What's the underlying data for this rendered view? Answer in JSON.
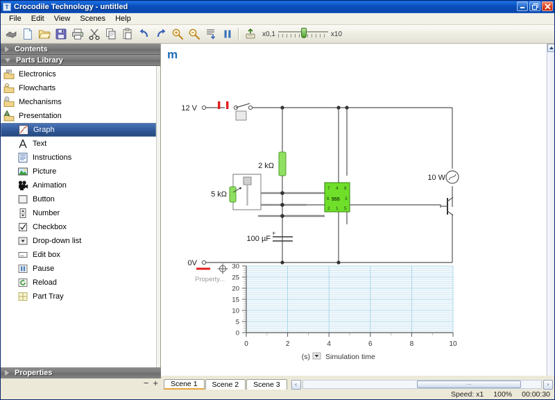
{
  "window": {
    "title": "Crocodile Technology - untitled",
    "icon": "T",
    "buttons": [
      {
        "name": "minimize",
        "glyph": "_"
      },
      {
        "name": "restore",
        "glyph": "❐"
      },
      {
        "name": "close",
        "glyph": "✕"
      }
    ]
  },
  "menubar": {
    "items": [
      "File",
      "Edit",
      "View",
      "Scenes",
      "Help"
    ]
  },
  "toolbar": {
    "buttons": [
      {
        "name": "select-tool-button",
        "icon": "pointer-icon",
        "title": "Select"
      },
      {
        "name": "new-button",
        "icon": "new-document-icon",
        "title": "New"
      },
      {
        "name": "open-button",
        "icon": "open-folder-icon",
        "title": "Open"
      },
      {
        "name": "save-button",
        "icon": "floppy-disk-icon",
        "title": "Save"
      },
      {
        "name": "print-button",
        "icon": "printer-icon",
        "title": "Print"
      },
      {
        "name": "cut-button",
        "icon": "scissors-icon",
        "title": "Cut"
      },
      {
        "name": "copy-button",
        "icon": "copy-icon",
        "title": "Copy"
      },
      {
        "name": "paste-button",
        "icon": "clipboard-paste-icon",
        "title": "Paste"
      },
      {
        "name": "undo-button",
        "icon": "undo-arrow-icon",
        "title": "Undo"
      },
      {
        "name": "redo-button",
        "icon": "redo-arrow-icon",
        "title": "Redo"
      },
      {
        "name": "zoom-in-button",
        "icon": "magnifier-plus-icon",
        "title": "Zoom In"
      },
      {
        "name": "zoom-out-button",
        "icon": "magnifier-minus-icon",
        "title": "Zoom Out"
      },
      {
        "name": "zoom-fit-button",
        "icon": "zoom-fit-icon",
        "title": "Zoom to fit"
      },
      {
        "name": "pause-button",
        "icon": "pause-icon",
        "title": "Pause"
      },
      {
        "name": "reset-button",
        "icon": "reset-icon",
        "title": "Reset"
      }
    ],
    "speed_min_label": "x0,1",
    "speed_max_label": "x10"
  },
  "sidebar": {
    "contents_header": "Contents",
    "parts_header": "Parts Library",
    "categories": [
      {
        "label": "Electronics",
        "icon": "electronics-folder-icon"
      },
      {
        "label": "Flowcharts",
        "icon": "flowcharts-folder-icon"
      },
      {
        "label": "Mechanisms",
        "icon": "mechanisms-folder-icon"
      },
      {
        "label": "Presentation",
        "icon": "presentation-folder-icon"
      }
    ],
    "presentation_items": [
      {
        "label": "Graph",
        "icon": "graph-icon",
        "selected": true
      },
      {
        "label": "Text",
        "icon": "text-a-icon",
        "selected": false
      },
      {
        "label": "Instructions",
        "icon": "instructions-icon",
        "selected": false
      },
      {
        "label": "Picture",
        "icon": "picture-icon",
        "selected": false
      },
      {
        "label": "Animation",
        "icon": "animation-camera-icon",
        "selected": false
      },
      {
        "label": "Button",
        "icon": "button-icon",
        "selected": false
      },
      {
        "label": "Number",
        "icon": "number-spinner-icon",
        "selected": false
      },
      {
        "label": "Checkbox",
        "icon": "checkbox-icon",
        "selected": false
      },
      {
        "label": "Drop-down list",
        "icon": "dropdown-icon",
        "selected": false
      },
      {
        "label": "Edit box",
        "icon": "edit-box-icon",
        "selected": false
      },
      {
        "label": "Pause",
        "icon": "pause-icon",
        "selected": false
      },
      {
        "label": "Reload",
        "icon": "reload-icon",
        "selected": false
      },
      {
        "label": "Part Tray",
        "icon": "part-tray-icon",
        "selected": false
      }
    ],
    "properties_header": "Properties"
  },
  "canvas": {
    "scene_label": "m",
    "circuit": {
      "labels": {
        "supply": "12 V",
        "ground": "0V",
        "resistor": "2 kΩ",
        "potentiometer": "5 kΩ",
        "capacitor": "100 µF",
        "lamp": "10 W",
        "ic": "555"
      },
      "ic_pins_top": [
        "7",
        "4",
        "8"
      ],
      "ic_pins_mid": [
        "6",
        "3"
      ],
      "ic_pins_bottom": [
        "2",
        "1",
        "5"
      ]
    }
  },
  "chart_data": {
    "type": "line",
    "title": "",
    "xlabel": "Simulation time",
    "x_unit": "(s)",
    "ylabel": "",
    "legend_label": "Property...",
    "legend_color": "#e02020",
    "xlim": [
      0,
      10
    ],
    "ylim": [
      0,
      30
    ],
    "x_ticks": [
      0,
      2,
      4,
      6,
      8,
      10
    ],
    "y_ticks": [
      0,
      5,
      10,
      15,
      20,
      25,
      30
    ],
    "grid": true,
    "grid_color": "#bfdcec",
    "plot_bg": "#f0f8fc",
    "series": [
      {
        "name": "Property...",
        "color": "#e02020",
        "x": [],
        "y": []
      }
    ]
  },
  "bottombar": {
    "minus_label": "−",
    "plus_label": "+",
    "scenes": [
      {
        "label": "Scene 1",
        "active": true
      },
      {
        "label": "Scene 2",
        "active": false
      },
      {
        "label": "Scene 3",
        "active": false
      }
    ],
    "scroll_left_glyph": "‹",
    "scroll_right_glyph": "›",
    "thumb_grip": "⋯"
  },
  "status": {
    "speed": "Speed: x1",
    "zoom": "100%",
    "time": "00:00:30"
  }
}
